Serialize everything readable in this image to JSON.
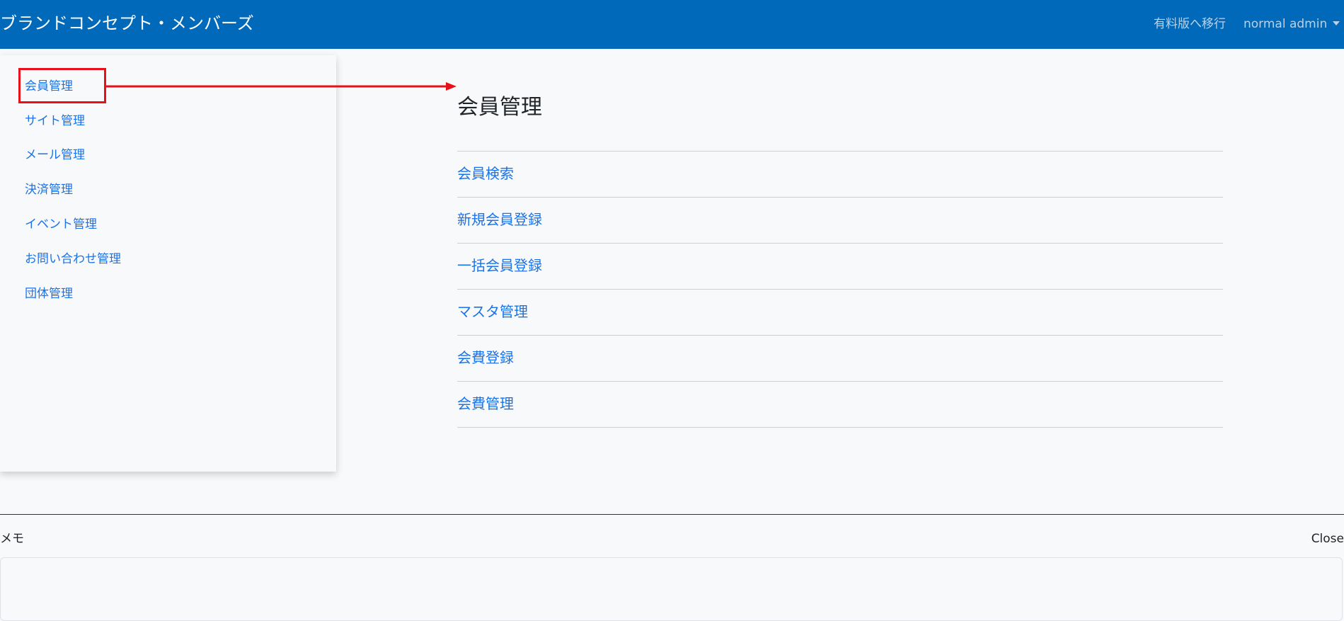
{
  "header": {
    "brand": "ブランドコンセプト・メンバーズ",
    "upgrade_link": "有料版へ移行",
    "user_menu": "normal admin"
  },
  "sidebar": {
    "items": [
      {
        "label": "会員管理",
        "highlighted": true
      },
      {
        "label": "サイト管理"
      },
      {
        "label": "メール管理"
      },
      {
        "label": "決済管理"
      },
      {
        "label": "イベント管理"
      },
      {
        "label": "お問い合わせ管理"
      },
      {
        "label": "団体管理"
      }
    ]
  },
  "main": {
    "title": "会員管理",
    "links": [
      {
        "label": "会員検索"
      },
      {
        "label": "新規会員登録"
      },
      {
        "label": "一括会員登録"
      },
      {
        "label": "マスタ管理"
      },
      {
        "label": "会費登録"
      },
      {
        "label": "会費管理"
      }
    ]
  },
  "memo": {
    "label": "メモ",
    "close_label": "Close",
    "value": ""
  },
  "colors": {
    "navbar": "#0069b9",
    "link": "#1a73e8",
    "annotation": "#e8101a",
    "background": "#f8f9fa"
  },
  "icons": {
    "user_menu_caret": "caret-down-icon",
    "annotation_arrow": "arrow-right-icon"
  }
}
